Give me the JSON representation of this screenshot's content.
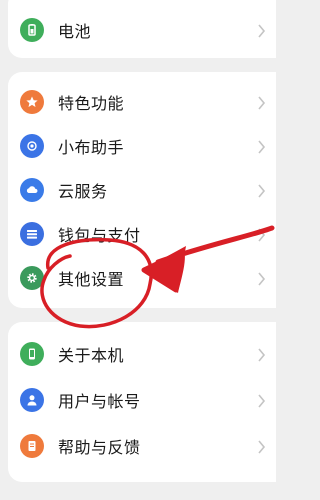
{
  "colors": {
    "battery": "#3fae5b",
    "features": "#ef7a3c",
    "assistant": "#3b74e6",
    "cloud": "#3a7be8",
    "wallet": "#3b6fe0",
    "other_settings": "#3a9a5c",
    "about": "#3fae5b",
    "account": "#3b74e6",
    "help": "#ef7a3c",
    "annotation": "#d81f26"
  },
  "items": [
    {
      "label": "电池",
      "icon": "battery-icon"
    },
    {
      "label": "特色功能",
      "icon": "star-icon"
    },
    {
      "label": "小布助手",
      "icon": "assistant-icon"
    },
    {
      "label": "云服务",
      "icon": "cloud-icon"
    },
    {
      "label": "钱包与支付",
      "icon": "wallet-icon"
    },
    {
      "label": "其他设置",
      "icon": "gear-icon"
    },
    {
      "label": "关于本机",
      "icon": "phone-icon"
    },
    {
      "label": "用户与帐号",
      "icon": "user-icon"
    },
    {
      "label": "帮助与反馈",
      "icon": "help-document-icon"
    }
  ]
}
